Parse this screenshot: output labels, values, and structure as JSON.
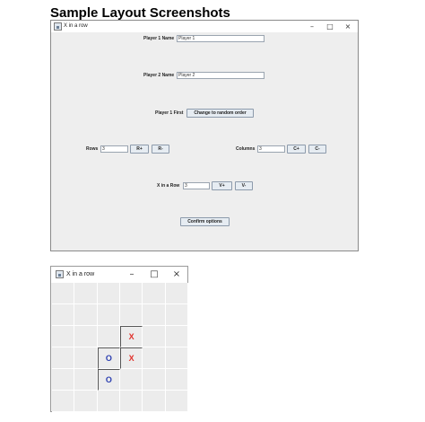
{
  "heading": "Sample Layout Screenshots",
  "options_window": {
    "title": "X in a row",
    "controls": {
      "minimize": "–",
      "maximize": "□",
      "close": "×"
    },
    "player1_label": "Player 1 Name",
    "player1_value": "Player 1",
    "player2_label": "Player 2 Name",
    "player2_value": "Player 2",
    "player1_first_label": "Player 1 First",
    "random_order_button": "Change to random order",
    "rows_label": "Rows",
    "rows_value": "3",
    "rows_plus": "R+",
    "rows_minus": "R-",
    "columns_label": "Columns",
    "columns_value": "3",
    "columns_plus": "C+",
    "columns_minus": "C-",
    "xinrow_label": "X in a Row",
    "xinrow_value": "3",
    "xinrow_plus": "V+",
    "xinrow_minus": "V-",
    "confirm_button": "Confirm options"
  },
  "game_window": {
    "title": "X in a row",
    "controls": {
      "minimize": "–",
      "maximize": "□",
      "close": "×"
    },
    "board": [
      [
        "",
        "",
        "",
        "",
        "",
        ""
      ],
      [
        "",
        "",
        "",
        "",
        "",
        ""
      ],
      [
        "",
        "",
        "",
        "X",
        "",
        ""
      ],
      [
        "",
        "",
        "O",
        "X",
        "",
        ""
      ],
      [
        "",
        "",
        "O",
        "",
        "",
        ""
      ],
      [
        "",
        "",
        "",
        "",
        "",
        ""
      ]
    ]
  }
}
